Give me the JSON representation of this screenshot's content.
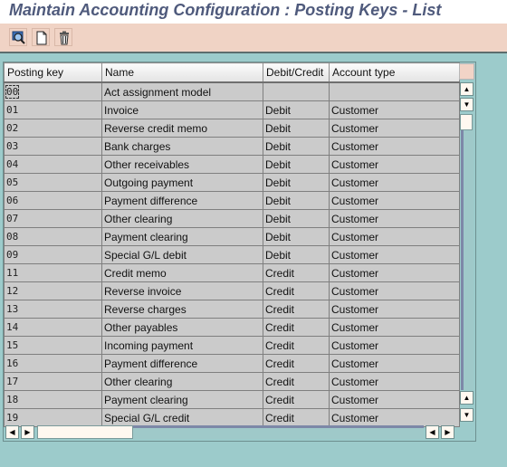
{
  "window": {
    "title": "Maintain Accounting Configuration : Posting Keys - List"
  },
  "toolbar": {
    "buttons": [
      {
        "name": "details-button",
        "icon": "magnifier-icon"
      },
      {
        "name": "new-entry-button",
        "icon": "new-document-icon"
      },
      {
        "name": "delete-button",
        "icon": "trash-icon"
      }
    ]
  },
  "table": {
    "columns": [
      "Posting key",
      "Name",
      "Debit/Credit",
      "Account type"
    ],
    "rows": [
      {
        "key": "00",
        "name": "Act assignment model",
        "dc": "",
        "acct": ""
      },
      {
        "key": "01",
        "name": "Invoice",
        "dc": "Debit",
        "acct": "Customer"
      },
      {
        "key": "02",
        "name": "Reverse credit memo",
        "dc": "Debit",
        "acct": "Customer"
      },
      {
        "key": "03",
        "name": "Bank charges",
        "dc": "Debit",
        "acct": "Customer"
      },
      {
        "key": "04",
        "name": "Other receivables",
        "dc": "Debit",
        "acct": "Customer"
      },
      {
        "key": "05",
        "name": "Outgoing payment",
        "dc": "Debit",
        "acct": "Customer"
      },
      {
        "key": "06",
        "name": "Payment difference",
        "dc": "Debit",
        "acct": "Customer"
      },
      {
        "key": "07",
        "name": "Other clearing",
        "dc": "Debit",
        "acct": "Customer"
      },
      {
        "key": "08",
        "name": "Payment clearing",
        "dc": "Debit",
        "acct": "Customer"
      },
      {
        "key": "09",
        "name": "Special G/L debit",
        "dc": "Debit",
        "acct": "Customer"
      },
      {
        "key": "11",
        "name": "Credit memo",
        "dc": "Credit",
        "acct": "Customer"
      },
      {
        "key": "12",
        "name": "Reverse invoice",
        "dc": "Credit",
        "acct": "Customer"
      },
      {
        "key": "13",
        "name": "Reverse charges",
        "dc": "Credit",
        "acct": "Customer"
      },
      {
        "key": "14",
        "name": "Other payables",
        "dc": "Credit",
        "acct": "Customer"
      },
      {
        "key": "15",
        "name": "Incoming payment",
        "dc": "Credit",
        "acct": "Customer"
      },
      {
        "key": "16",
        "name": "Payment difference",
        "dc": "Credit",
        "acct": "Customer"
      },
      {
        "key": "17",
        "name": "Other clearing",
        "dc": "Credit",
        "acct": "Customer"
      },
      {
        "key": "18",
        "name": "Payment clearing",
        "dc": "Credit",
        "acct": "Customer"
      },
      {
        "key": "19",
        "name": "Special G/L credit",
        "dc": "Credit",
        "acct": "Customer"
      }
    ]
  },
  "scrollbars": {
    "up_glyph": "▲",
    "down_glyph": "▼",
    "left_glyph": "◀",
    "right_glyph": "▶"
  }
}
